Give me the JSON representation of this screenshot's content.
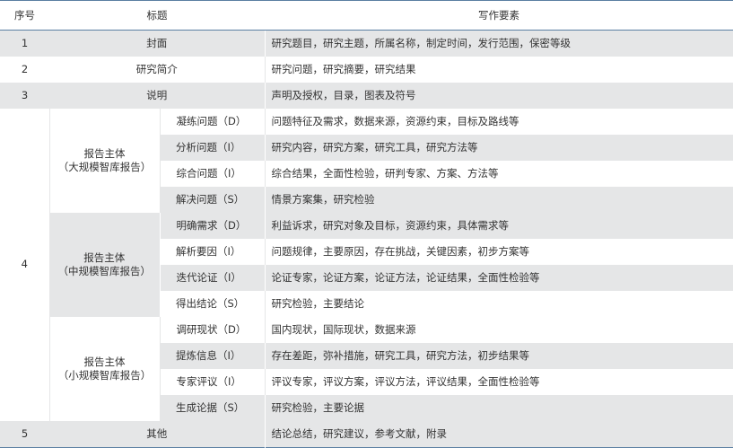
{
  "header": {
    "no": "序号",
    "title": "标题",
    "req": "写作要素"
  },
  "rows": {
    "r1": {
      "no": "1",
      "title": "封面",
      "req": "研究题目，研究主题，所属名称，制定时间，发行范围，保密等级"
    },
    "r2": {
      "no": "2",
      "title": "研究简介",
      "req": "研究问题，研究摘要，研究结果"
    },
    "r3": {
      "no": "3",
      "title": "说明",
      "req": "声明及授权，目录，图表及符号"
    },
    "r4": {
      "no": "4"
    },
    "r5": {
      "no": "5",
      "title": "其他",
      "req": "结论总结，研究建议，参考文献，附录"
    }
  },
  "groups": {
    "large": {
      "line1": "报告主体",
      "line2": "（大规模智库报告）"
    },
    "medium": {
      "line1": "报告主体",
      "line2": "（中规模智库报告）"
    },
    "small": {
      "line1": "报告主体",
      "line2": "（小规模智库报告）"
    }
  },
  "large": [
    {
      "sub": "凝练问题（D）",
      "req": "问题特征及需求，数据来源，资源约束，目标及路线等"
    },
    {
      "sub": "分析问题（I）",
      "req": "研究内容，研究方案，研究工具，研究方法等"
    },
    {
      "sub": "综合问题（I）",
      "req": "综合结果，全面性检验，研判专家、方案、方法等"
    },
    {
      "sub": "解决问题（S）",
      "req": "情景方案集，研究检验"
    }
  ],
  "medium": [
    {
      "sub": "明确需求（D）",
      "req": "利益诉求，研究对象及目标，资源约束，具体需求等"
    },
    {
      "sub": "解析要因（I）",
      "req": "问题规律，主要原因，存在挑战，关键因素，初步方案等"
    },
    {
      "sub": "迭代论证（I）",
      "req": "论证专家，论证方案，论证方法，论证结果，全面性检验等"
    },
    {
      "sub": "得出结论（S）",
      "req": "研究检验，主要结论"
    }
  ],
  "small": [
    {
      "sub": "调研现状（D）",
      "req": "国内现状，国际现状，数据来源"
    },
    {
      "sub": "提炼信息（I）",
      "req": "存在差距，弥补措施，研究工具，研究方法，初步结果等"
    },
    {
      "sub": "专家评议（I）",
      "req": "评议专家，评议方案，评议方法，评议结果，全面性检验等"
    },
    {
      "sub": "生成论据（S）",
      "req": "研究检验，主要论据"
    }
  ],
  "colors": {
    "grey": "#e5e6e7",
    "rule": "#5b7fa2",
    "text": "#333333"
  }
}
